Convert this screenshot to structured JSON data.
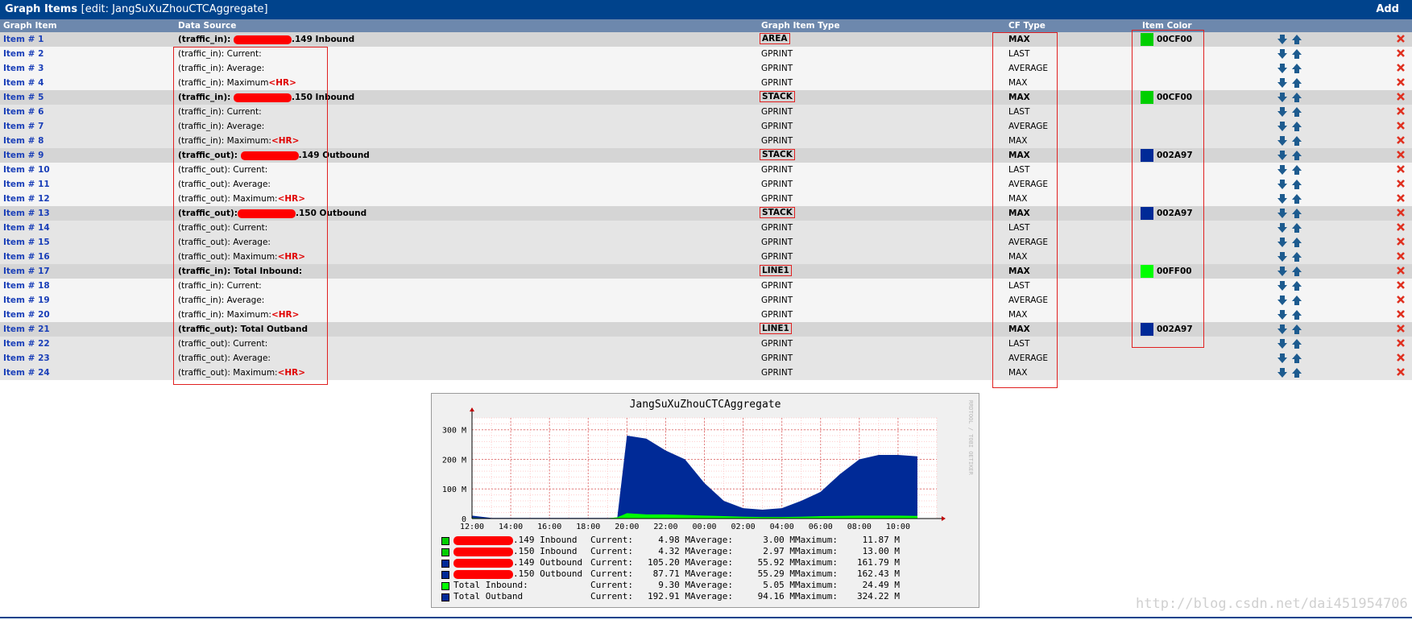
{
  "title": {
    "main": "Graph Items",
    "edit": "[edit: JangSuXuZhouCTCAggregate]",
    "add_label": "Add"
  },
  "columns": [
    "Graph Item",
    "Data Source",
    "Graph Item Type",
    "CF Type",
    "Item Color"
  ],
  "rows": [
    {
      "item": "Item # 1",
      "ds_prefix": "(traffic_in): ",
      "ds_suffix": ".149 Inbound",
      "hr": "",
      "type": "AREA",
      "cf": "MAX",
      "color": "00CF00",
      "color_hex": "#00cf00",
      "bold": true,
      "boxed_type": true
    },
    {
      "item": "Item # 2",
      "ds_prefix": "(traffic_in): Current:",
      "ds_suffix": "",
      "hr": "",
      "type": "GPRINT",
      "cf": "LAST",
      "color": "",
      "color_hex": "",
      "bold": false
    },
    {
      "item": "Item # 3",
      "ds_prefix": "(traffic_in): Average:",
      "ds_suffix": "",
      "hr": "",
      "type": "GPRINT",
      "cf": "AVERAGE",
      "color": "",
      "color_hex": "",
      "bold": false
    },
    {
      "item": "Item # 4",
      "ds_prefix": "(traffic_in): Maximum",
      "ds_suffix": "",
      "hr": "<HR>",
      "type": "GPRINT",
      "cf": "MAX",
      "color": "",
      "color_hex": "",
      "bold": false
    },
    {
      "item": "Item # 5",
      "ds_prefix": "(traffic_in): ",
      "ds_suffix": ".150 Inbound",
      "hr": "",
      "type": "STACK",
      "cf": "MAX",
      "color": "00CF00",
      "color_hex": "#00cf00",
      "bold": true,
      "boxed_type": true
    },
    {
      "item": "Item # 6",
      "ds_prefix": "(traffic_in): Current:",
      "ds_suffix": "",
      "hr": "",
      "type": "GPRINT",
      "cf": "LAST",
      "color": "",
      "color_hex": "",
      "bold": false
    },
    {
      "item": "Item # 7",
      "ds_prefix": "(traffic_in): Average:",
      "ds_suffix": "",
      "hr": "",
      "type": "GPRINT",
      "cf": "AVERAGE",
      "color": "",
      "color_hex": "",
      "bold": false
    },
    {
      "item": "Item # 8",
      "ds_prefix": "(traffic_in): Maximum:",
      "ds_suffix": "",
      "hr": "<HR>",
      "type": "GPRINT",
      "cf": "MAX",
      "color": "",
      "color_hex": "",
      "bold": false
    },
    {
      "item": "Item # 9",
      "ds_prefix": "(traffic_out): ",
      "ds_suffix": ".149 Outbound",
      "hr": "",
      "type": "STACK",
      "cf": "MAX",
      "color": "002A97",
      "color_hex": "#002a97",
      "bold": true,
      "boxed_type": true
    },
    {
      "item": "Item # 10",
      "ds_prefix": "(traffic_out): Current:",
      "ds_suffix": "",
      "hr": "",
      "type": "GPRINT",
      "cf": "LAST",
      "color": "",
      "color_hex": "",
      "bold": false
    },
    {
      "item": "Item # 11",
      "ds_prefix": "(traffic_out): Average:",
      "ds_suffix": "",
      "hr": "",
      "type": "GPRINT",
      "cf": "AVERAGE",
      "color": "",
      "color_hex": "",
      "bold": false
    },
    {
      "item": "Item # 12",
      "ds_prefix": "(traffic_out): Maximum:",
      "ds_suffix": "",
      "hr": "<HR>",
      "type": "GPRINT",
      "cf": "MAX",
      "color": "",
      "color_hex": "",
      "bold": false
    },
    {
      "item": "Item # 13",
      "ds_prefix": "(traffic_out):",
      "ds_suffix": ".150 Outbound",
      "hr": "",
      "type": "STACK",
      "cf": "MAX",
      "color": "002A97",
      "color_hex": "#002a97",
      "bold": true,
      "boxed_type": true
    },
    {
      "item": "Item # 14",
      "ds_prefix": "(traffic_out): Current:",
      "ds_suffix": "",
      "hr": "",
      "type": "GPRINT",
      "cf": "LAST",
      "color": "",
      "color_hex": "",
      "bold": false
    },
    {
      "item": "Item # 15",
      "ds_prefix": "(traffic_out): Average:",
      "ds_suffix": "",
      "hr": "",
      "type": "GPRINT",
      "cf": "AVERAGE",
      "color": "",
      "color_hex": "",
      "bold": false
    },
    {
      "item": "Item # 16",
      "ds_prefix": "(traffic_out): Maximum:",
      "ds_suffix": "",
      "hr": "<HR>",
      "type": "GPRINT",
      "cf": "MAX",
      "color": "",
      "color_hex": "",
      "bold": false
    },
    {
      "item": "Item # 17",
      "ds_prefix": "(traffic_in): Total Inbound:",
      "ds_suffix": "",
      "hr": "",
      "type": "LINE1",
      "cf": "MAX",
      "color": "00FF00",
      "color_hex": "#00ff00",
      "bold": true,
      "boxed_type": true
    },
    {
      "item": "Item # 18",
      "ds_prefix": "(traffic_in): Current:",
      "ds_suffix": "",
      "hr": "",
      "type": "GPRINT",
      "cf": "LAST",
      "color": "",
      "color_hex": "",
      "bold": false
    },
    {
      "item": "Item # 19",
      "ds_prefix": "(traffic_in): Average:",
      "ds_suffix": "",
      "hr": "",
      "type": "GPRINT",
      "cf": "AVERAGE",
      "color": "",
      "color_hex": "",
      "bold": false
    },
    {
      "item": "Item # 20",
      "ds_prefix": "(traffic_in): Maximum:",
      "ds_suffix": "",
      "hr": "<HR>",
      "type": "GPRINT",
      "cf": "MAX",
      "color": "",
      "color_hex": "",
      "bold": false
    },
    {
      "item": "Item # 21",
      "ds_prefix": "(traffic_out): Total Outband",
      "ds_suffix": "",
      "hr": "",
      "type": "LINE1",
      "cf": "MAX",
      "color": "002A97",
      "color_hex": "#002a97",
      "bold": true,
      "boxed_type": true
    },
    {
      "item": "Item # 22",
      "ds_prefix": "(traffic_out): Current:",
      "ds_suffix": "",
      "hr": "",
      "type": "GPRINT",
      "cf": "LAST",
      "color": "",
      "color_hex": "",
      "bold": false
    },
    {
      "item": "Item # 23",
      "ds_prefix": "(traffic_out): Average:",
      "ds_suffix": "",
      "hr": "",
      "type": "GPRINT",
      "cf": "AVERAGE",
      "color": "",
      "color_hex": "",
      "bold": false
    },
    {
      "item": "Item # 24",
      "ds_prefix": "(traffic_out): Maximum:",
      "ds_suffix": "",
      "hr": "<HR>",
      "type": "GPRINT",
      "cf": "MAX",
      "color": "",
      "color_hex": "",
      "bold": false
    }
  ],
  "icons": {
    "move_down": "arrow-down-icon",
    "move_up": "arrow-up-icon",
    "delete": "delete-x-icon"
  },
  "colors": {
    "title_bar": "#00438c",
    "header_bar": "#6d88ad",
    "link": "#1a3fb8",
    "annotation_red": "#e02020",
    "area_green": "#00cf00",
    "stack_blue": "#002a97"
  },
  "graph": {
    "title": "JangSuXuZhouCTCAggregate",
    "watermark": "RRDTOOL / TOBI OETIKER"
  },
  "chart_data": {
    "type": "area",
    "title": "JangSuXuZhouCTCAggregate",
    "y_ticks": [
      "0",
      "100 M",
      "200 M",
      "300 M"
    ],
    "x_ticks": [
      "12:00",
      "14:00",
      "16:00",
      "18:00",
      "20:00",
      "22:00",
      "00:00",
      "02:00",
      "04:00",
      "06:00",
      "08:00",
      "10:00"
    ],
    "ylim": [
      0,
      340
    ],
    "grid": true,
    "series": [
      {
        "name": "Total Inbound",
        "color": "#00ff00",
        "x": [
          "12:00",
          "13:00",
          "14:00",
          "15:00",
          "16:00",
          "17:00",
          "18:00",
          "19:00",
          "19:30",
          "20:00",
          "21:00",
          "22:00",
          "23:00",
          "00:00",
          "01:00",
          "02:00",
          "03:00",
          "04:00",
          "05:00",
          "06:00",
          "07:00",
          "08:00",
          "09:00",
          "10:00",
          "11:00"
        ],
        "values": [
          2,
          1,
          1,
          1,
          1,
          1,
          1,
          1,
          4,
          18,
          14,
          14,
          12,
          10,
          8,
          6,
          5,
          5,
          6,
          8,
          9,
          10,
          10,
          10,
          9
        ]
      },
      {
        "name": "Total Outband",
        "color": "#002a97",
        "x": [
          "12:00",
          "13:00",
          "14:00",
          "15:00",
          "16:00",
          "17:00",
          "18:00",
          "19:00",
          "19:30",
          "20:00",
          "21:00",
          "22:00",
          "23:00",
          "00:00",
          "01:00",
          "02:00",
          "03:00",
          "04:00",
          "05:00",
          "06:00",
          "07:00",
          "08:00",
          "09:00",
          "10:00",
          "11:00"
        ],
        "values": [
          10,
          2,
          2,
          2,
          2,
          2,
          2,
          2,
          2,
          280,
          270,
          230,
          200,
          120,
          60,
          35,
          30,
          35,
          60,
          90,
          150,
          200,
          215,
          215,
          210
        ]
      }
    ]
  },
  "legend": [
    {
      "name": ".149 Inbound",
      "current": "4.98 M",
      "average": "3.00 M",
      "maximum": "11.87 M",
      "color": "#00cf00",
      "redacted": true
    },
    {
      "name": ".150 Inbound",
      "current": "4.32 M",
      "average": "2.97 M",
      "maximum": "13.00 M",
      "color": "#00cf00",
      "redacted": true
    },
    {
      "name": ".149 Outbound",
      "current": "105.20 M",
      "average": "55.92 M",
      "maximum": "161.79 M",
      "color": "#002a97",
      "redacted": true
    },
    {
      "name": ".150 Outbound",
      "current": "87.71 M",
      "average": "55.29 M",
      "maximum": "162.43 M",
      "color": "#002a97",
      "redacted": true
    },
    {
      "name": "Total Inbound:",
      "current": "9.30 M",
      "average": "5.05 M",
      "maximum": "24.49 M",
      "color": "#00ff00",
      "redacted": false
    },
    {
      "name": "Total Outband",
      "current": "192.91 M",
      "average": "94.16 M",
      "maximum": "324.22 M",
      "color": "#002a97",
      "redacted": false
    }
  ],
  "legend_labels": {
    "current": "Current:",
    "average": "Average:",
    "maximum": "Maximum:"
  },
  "page_watermark": "http://blog.csdn.net/dai451954706"
}
